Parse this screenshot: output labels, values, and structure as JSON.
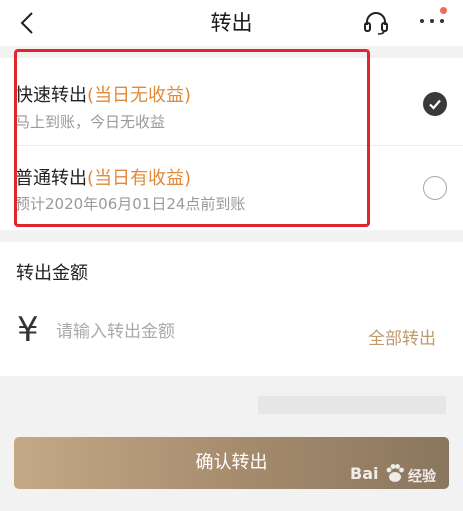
{
  "header": {
    "title": "转出"
  },
  "options": [
    {
      "label": "快速转出",
      "note": "(当日无收益)",
      "desc": "马上到账，今日无收益",
      "selected": true
    },
    {
      "label": "普通转出",
      "note": "(当日有收益)",
      "desc": "预计2020年06月01日24点前到账",
      "selected": false
    }
  ],
  "amount": {
    "label": "转出金额",
    "currency_symbol": "¥",
    "placeholder": "请输入转出金额",
    "all_button": "全部转出"
  },
  "confirm_button": "确认转出",
  "watermark": {
    "brand": "Bai",
    "suffix": "经验"
  },
  "colors": {
    "accent_orange": "#e08a3a",
    "gold": "#c09a6b",
    "highlight_red": "#e0262c",
    "button_start": "#c4a987",
    "button_end": "#8a765e"
  }
}
